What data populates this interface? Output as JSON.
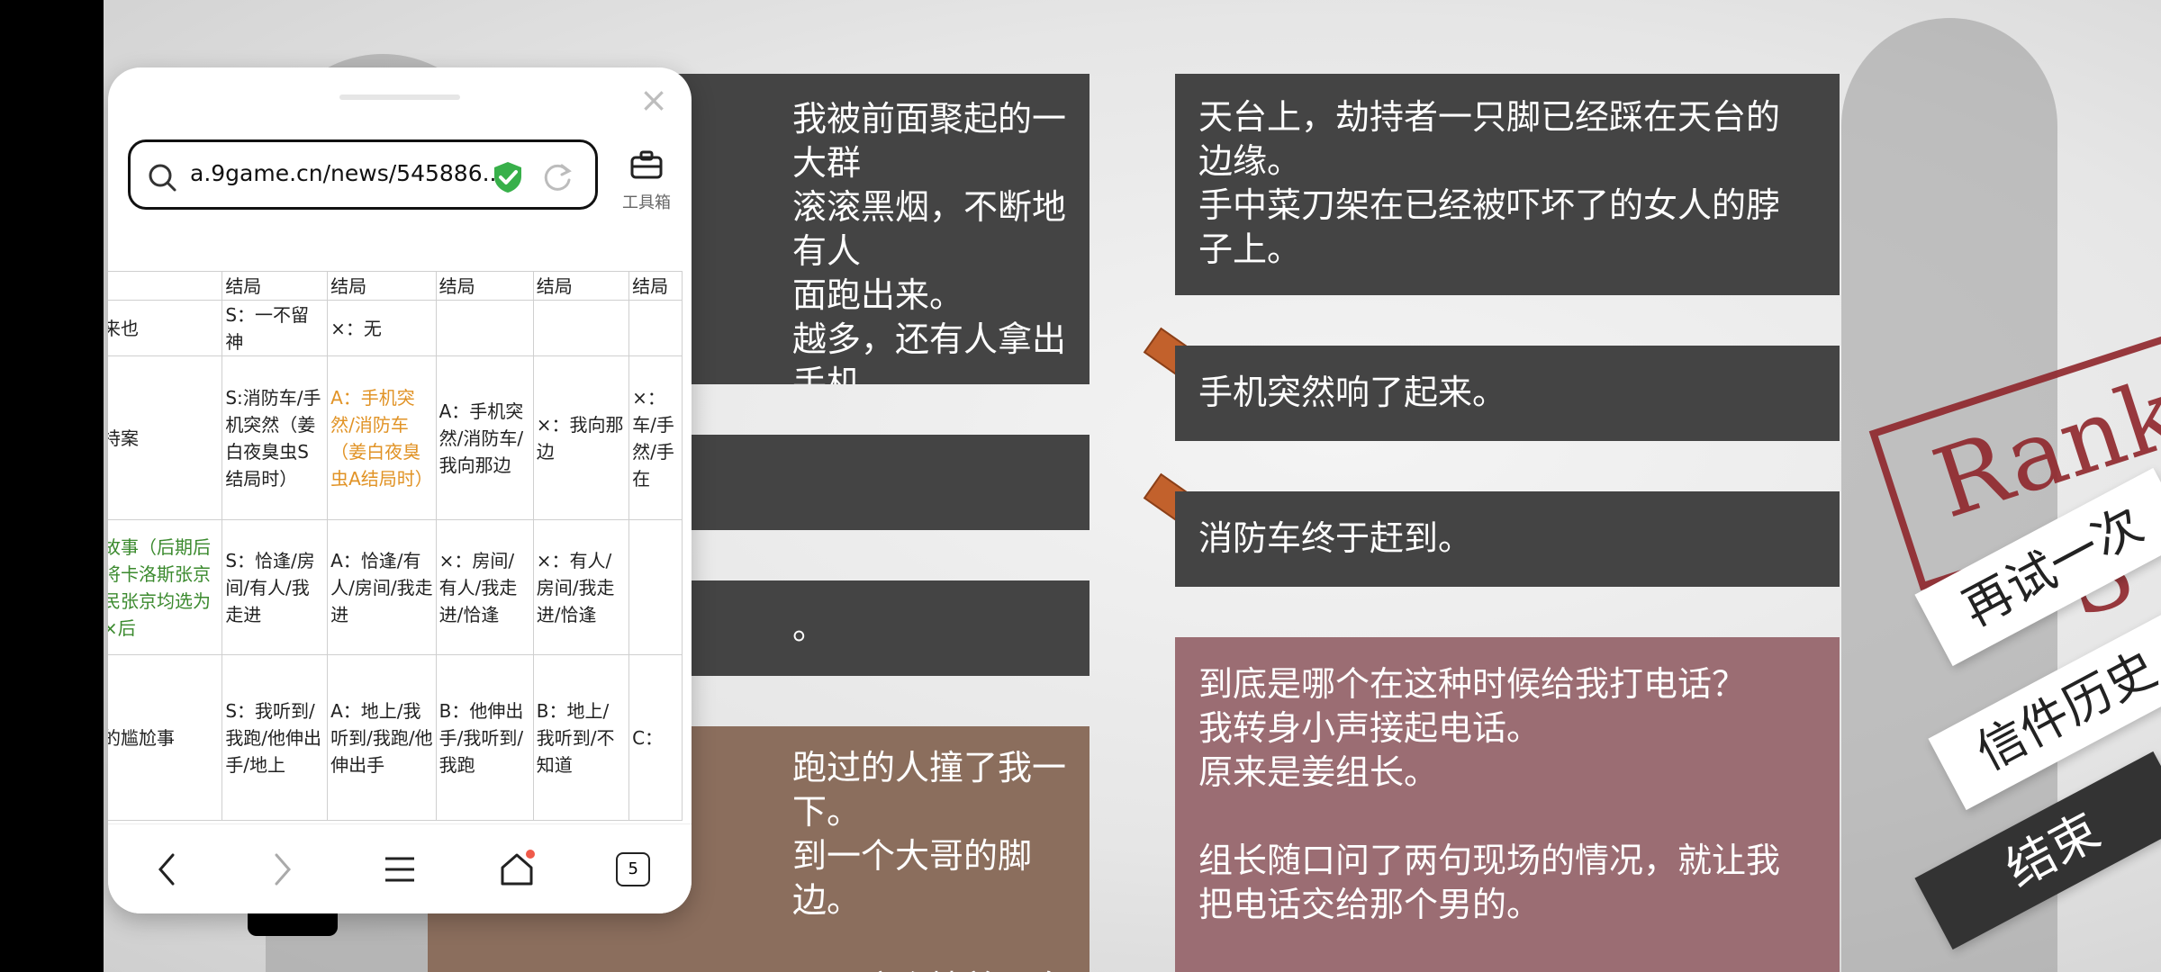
{
  "game": {
    "cards": [
      {
        "text": "我被前面聚起的一大群\n滚滚黑烟，不断地有人\n面跑出来。\n越多，还有人拿出手机"
      },
      {
        "text": ""
      },
      {
        "text": "。"
      },
      {
        "text": "跑过的人撞了我一下。\n到一个大哥的脚边。\n\n，而这个披着一身黑色风\n衣的大哥却带了好多人来灭火。"
      },
      {
        "text": "天台上，劫持者一只脚已经踩在天台的\n边缘。\n手中菜刀架在已经被吓坏了的女人的脖\n子上。"
      },
      {
        "text": "手机突然响了起来。"
      },
      {
        "text": "消防车终于赶到。"
      },
      {
        "text": "到底是哪个在这种时候给我打电话？\n我转身小声接起电话。\n原来是姜组长。\n\n组长随口问了两句现场的情况，就让我\n把电话交给那个男的。"
      }
    ],
    "stamp": "Rank S",
    "menu": {
      "retry": "再试一次",
      "letters": "信件历史",
      "end": "结束"
    }
  },
  "browser": {
    "url": "a.9game.cn/news/545886...",
    "toolbox_label": "工具箱",
    "tabs_count": "5",
    "table": {
      "header": [
        "",
        "结局",
        "结局",
        "结局",
        "结局",
        "结局"
      ],
      "rows": [
        [
          "来也",
          "S：一不留神",
          "×：无",
          "",
          "",
          ""
        ],
        [
          "持案",
          "S:消防车/手机突然（姜白夜臭虫S结局时）",
          "A：手机突然/消防车（姜白夜臭虫A结局时）",
          "A：手机突然/消防车/我向那边",
          "×：我向那边",
          "×：车/手然/手在"
        ],
        [
          "故事（后期后将卡洛斯张京民张京均选为×后",
          "S：恰逢/房间/有人/我走进",
          "A：恰逢/有人/房间/我走进",
          "×：房间/有人/我走进/恰逢",
          "×：有人/房间/我走进/恰逢",
          ""
        ],
        [
          "的尴尬事",
          "S：我听到/我跑/他伸出手/地上",
          "A：地上/我听到/我跑/他伸出手",
          "B：他伸出手/我听到/我跑",
          "B：地上/我听到/不知道",
          "C："
        ]
      ]
    }
  }
}
